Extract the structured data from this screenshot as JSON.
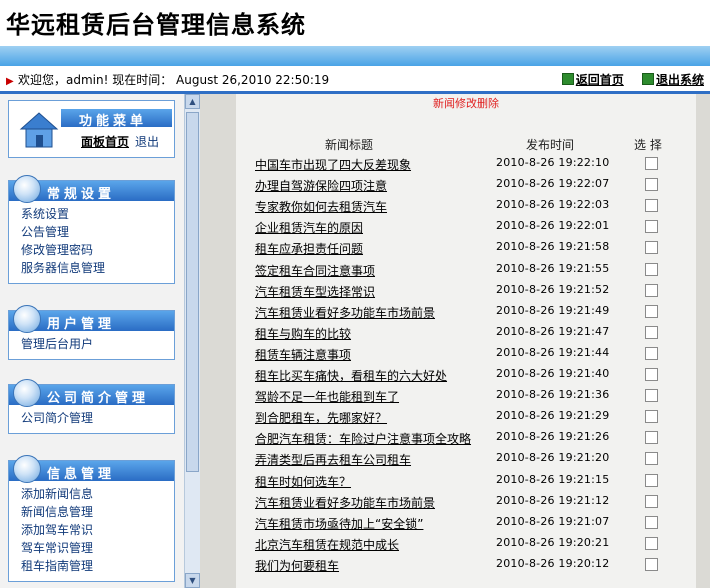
{
  "header": {
    "title": "华远租赁后台管理信息系统"
  },
  "status": {
    "welcome": "欢迎您，admin! 现在时间： August 26,2010 22:50:19",
    "back_home": "返回首页",
    "logout": "退出系统"
  },
  "sidebar": {
    "top": {
      "title": "功能菜单",
      "home": "面板首页",
      "exit": "退出"
    },
    "groups": [
      {
        "title": "常规设置",
        "items": [
          "系统设置",
          "公告管理",
          "修改管理密码",
          "服务器信息管理"
        ]
      },
      {
        "title": "用户管理",
        "items": [
          "管理后台用户"
        ]
      },
      {
        "title": "公司简介管理",
        "items": [
          "公司简介管理"
        ]
      },
      {
        "title": "信息管理",
        "items": [
          "添加新闻信息",
          "新闻信息管理",
          "添加驾车常识",
          "驾车常识管理",
          "租车指南管理"
        ]
      }
    ]
  },
  "panel": {
    "title": "新闻修改删除",
    "columns": {
      "title": "新闻标题",
      "date": "发布时间",
      "select": "选 择"
    },
    "rows": [
      {
        "title": "中国车市出现了四大反差现象",
        "date": "2010-8-26 19:22:10"
      },
      {
        "title": "办理自驾游保险四项注意",
        "date": "2010-8-26 19:22:07"
      },
      {
        "title": "专家教你如何去租赁汽车",
        "date": "2010-8-26 19:22:03"
      },
      {
        "title": "企业租赁汽车的原因",
        "date": "2010-8-26 19:22:01"
      },
      {
        "title": "租车应承担责任问题",
        "date": "2010-8-26 19:21:58"
      },
      {
        "title": "签定租车合同注意事项",
        "date": "2010-8-26 19:21:55"
      },
      {
        "title": "汽车租赁车型选择常识",
        "date": "2010-8-26 19:21:52"
      },
      {
        "title": "汽车租赁业看好多功能车市场前景",
        "date": "2010-8-26 19:21:49"
      },
      {
        "title": "租车与购车的比较",
        "date": "2010-8-26 19:21:47"
      },
      {
        "title": "租赁车辆注意事项",
        "date": "2010-8-26 19:21:44"
      },
      {
        "title": "租车比买车痛快，看租车的六大好处",
        "date": "2010-8-26 19:21:40"
      },
      {
        "title": "驾龄不足一年也能租到车了",
        "date": "2010-8-26 19:21:36"
      },
      {
        "title": "到合肥租车，先哪家好？",
        "date": "2010-8-26 19:21:29"
      },
      {
        "title": "合肥汽车租赁：车险过户注意事项全攻略",
        "date": "2010-8-26 19:21:26"
      },
      {
        "title": "弄清类型后再去租车公司租车",
        "date": "2010-8-26 19:21:20"
      },
      {
        "title": "租车时如何选车？",
        "date": "2010-8-26 19:21:15"
      },
      {
        "title": "汽车租赁业看好多功能车市场前景",
        "date": "2010-8-26 19:21:12"
      },
      {
        "title": "汽车租赁市场亟待加上“安全锁”",
        "date": "2010-8-26 19:21:07"
      },
      {
        "title": "北京汽车租赁在规范中成长",
        "date": "2010-8-26 19:20:21"
      },
      {
        "title": "我们为何要租车",
        "date": "2010-8-26 19:20:12"
      }
    ]
  }
}
